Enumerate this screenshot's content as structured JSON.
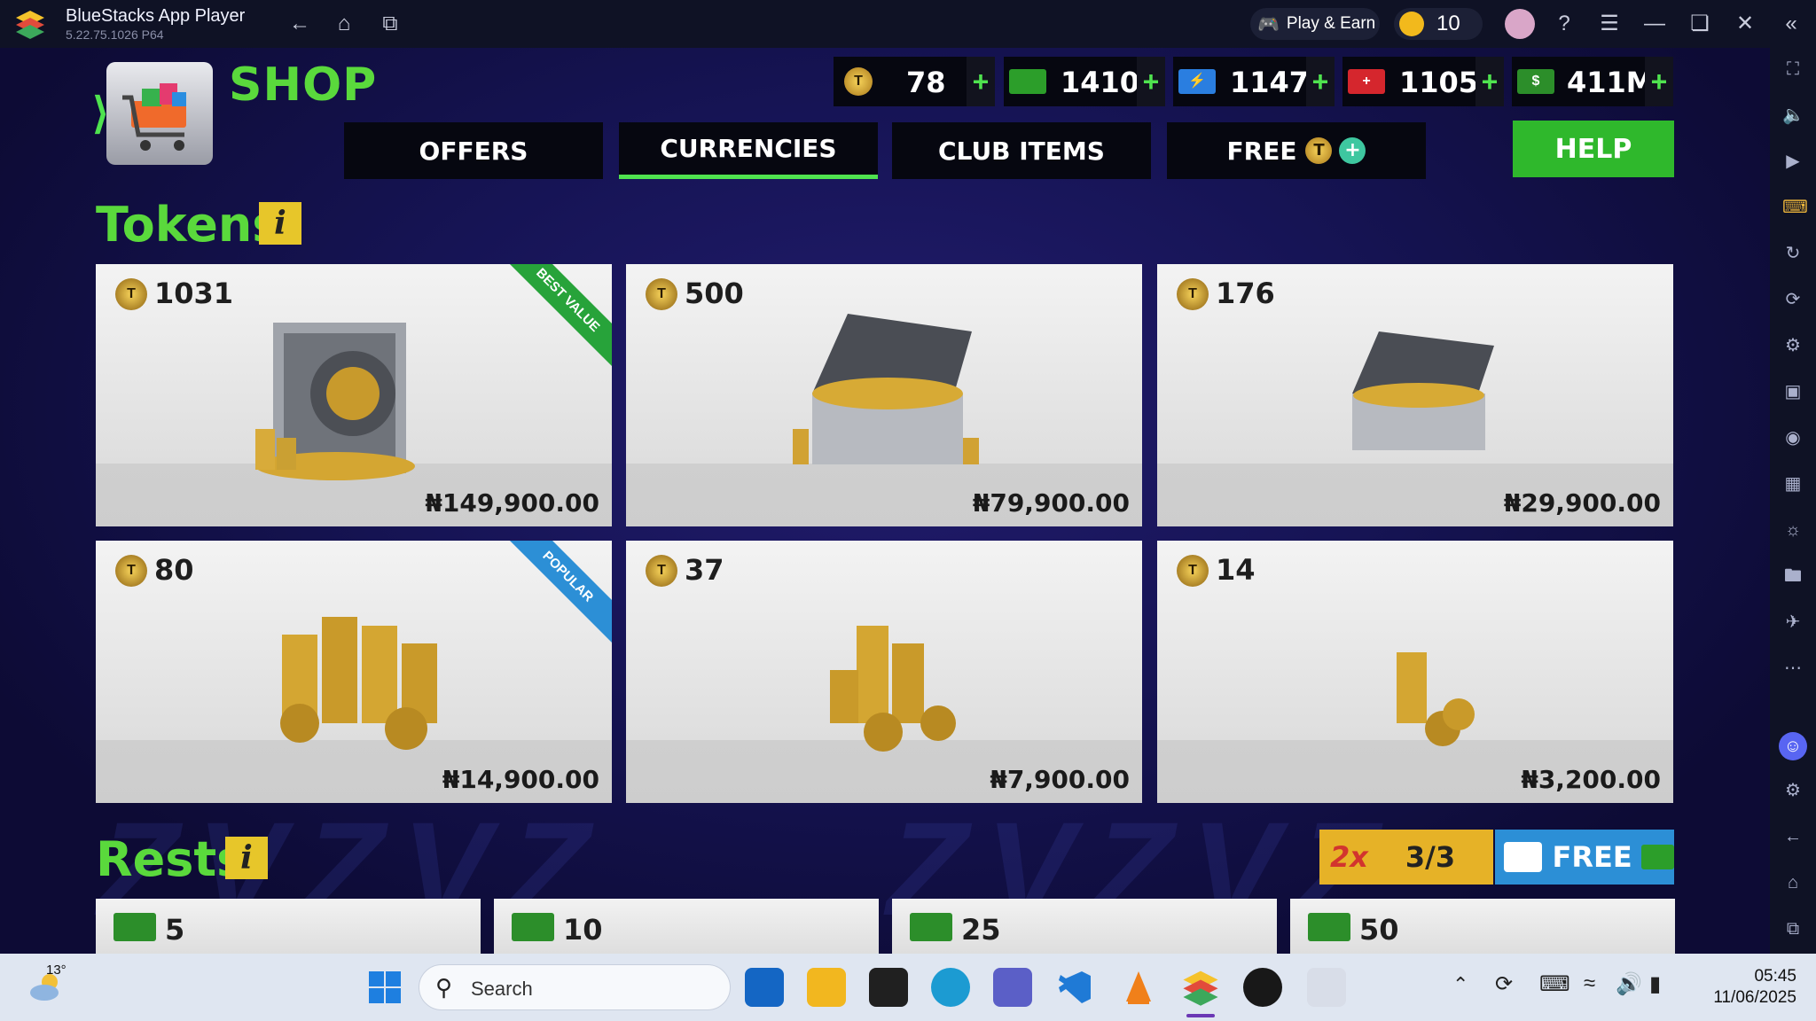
{
  "window": {
    "app_title": "BlueStacks App Player",
    "version": "5.22.75.1026 P64",
    "play_earn_label": "Play & Earn",
    "coin_count": "10"
  },
  "shop": {
    "title": "SHOP",
    "currencies": [
      {
        "icon": "token-icon",
        "value": "78",
        "plus": "+"
      },
      {
        "icon": "rest-cash-icon",
        "value": "1410",
        "plus": "+"
      },
      {
        "icon": "energy-icon",
        "value": "1147",
        "plus": "+"
      },
      {
        "icon": "medical-icon",
        "value": "1105",
        "plus": "+"
      },
      {
        "icon": "money-icon",
        "value": "411M",
        "plus": "+"
      }
    ],
    "tabs": [
      {
        "label": "OFFERS",
        "active": false
      },
      {
        "label": "CURRENCIES",
        "active": true
      },
      {
        "label": "CLUB ITEMS",
        "active": false
      },
      {
        "label": "FREE",
        "active": false
      }
    ],
    "help_label": "HELP"
  },
  "tokens": {
    "title": "Tokens",
    "info": "i",
    "items": [
      {
        "amount": "1031",
        "price": "₦149,900.00",
        "ribbon": "BEST VALUE",
        "art": "vault"
      },
      {
        "amount": "500",
        "price": "₦79,900.00",
        "ribbon": "",
        "art": "open-case-large"
      },
      {
        "amount": "176",
        "price": "₦29,900.00",
        "ribbon": "",
        "art": "open-case"
      },
      {
        "amount": "80",
        "price": "₦14,900.00",
        "ribbon": "POPULAR",
        "art": "coin-stacks-large"
      },
      {
        "amount": "37",
        "price": "₦7,900.00",
        "ribbon": "",
        "art": "coin-stacks"
      },
      {
        "amount": "14",
        "price": "₦3,200.00",
        "ribbon": "",
        "art": "coin-stack-small"
      }
    ]
  },
  "rests": {
    "title": "Rests",
    "info": "i",
    "multiplier": "2x",
    "progress": "3/3",
    "free_label": "FREE",
    "items": [
      {
        "amount": "5"
      },
      {
        "amount": "10"
      },
      {
        "amount": "25"
      },
      {
        "amount": "50"
      }
    ]
  },
  "taskbar": {
    "weather_temp": "13°",
    "search_placeholder": "Search",
    "time": "05:45",
    "date": "11/06/2025"
  },
  "colors": {
    "accent_green": "#5ad93c",
    "help_green": "#2fb82c",
    "best_value_ribbon": "#27a33a",
    "popular_ribbon": "#2c8fd6"
  }
}
